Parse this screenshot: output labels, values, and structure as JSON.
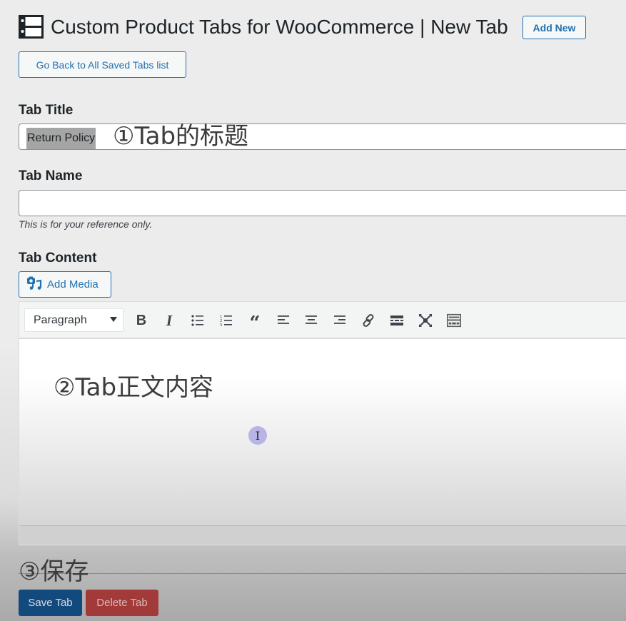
{
  "header": {
    "title": "Custom Product Tabs for WooCommerce | New Tab",
    "icon": "tabs-table-icon",
    "add_new_label": "Add New",
    "go_back_label": "Go Back to All Saved Tabs list"
  },
  "form": {
    "tab_title": {
      "label": "Tab Title",
      "value": "Return Policy"
    },
    "tab_name": {
      "label": "Tab Name",
      "value": "",
      "hint": "This is for your reference only."
    },
    "tab_content": {
      "label": "Tab Content",
      "add_media_label": "Add Media",
      "format_select": "Paragraph",
      "toolbar": [
        {
          "name": "bold",
          "icon": "bold-icon"
        },
        {
          "name": "italic",
          "icon": "italic-icon"
        },
        {
          "name": "bulleted-list",
          "icon": "bulleted-list-icon"
        },
        {
          "name": "numbered-list",
          "icon": "numbered-list-icon"
        },
        {
          "name": "blockquote",
          "icon": "blockquote-icon"
        },
        {
          "name": "align-left",
          "icon": "align-left-icon"
        },
        {
          "name": "align-center",
          "icon": "align-center-icon"
        },
        {
          "name": "align-right",
          "icon": "align-right-icon"
        },
        {
          "name": "insert-link",
          "icon": "link-icon"
        },
        {
          "name": "read-more",
          "icon": "read-more-icon"
        },
        {
          "name": "fullscreen",
          "icon": "fullscreen-icon"
        },
        {
          "name": "toolbar-toggle",
          "icon": "keyboard-icon"
        }
      ]
    }
  },
  "annotations": {
    "step1": "①Tab的标题",
    "step2": "②Tab正文内容",
    "step3": "③保存"
  },
  "cursor": "I",
  "actions": {
    "save_label": "Save Tab",
    "delete_label": "Delete Tab"
  },
  "colors": {
    "primary": "#2271b1",
    "save": "#134a7d",
    "delete": "#a33a3a"
  }
}
